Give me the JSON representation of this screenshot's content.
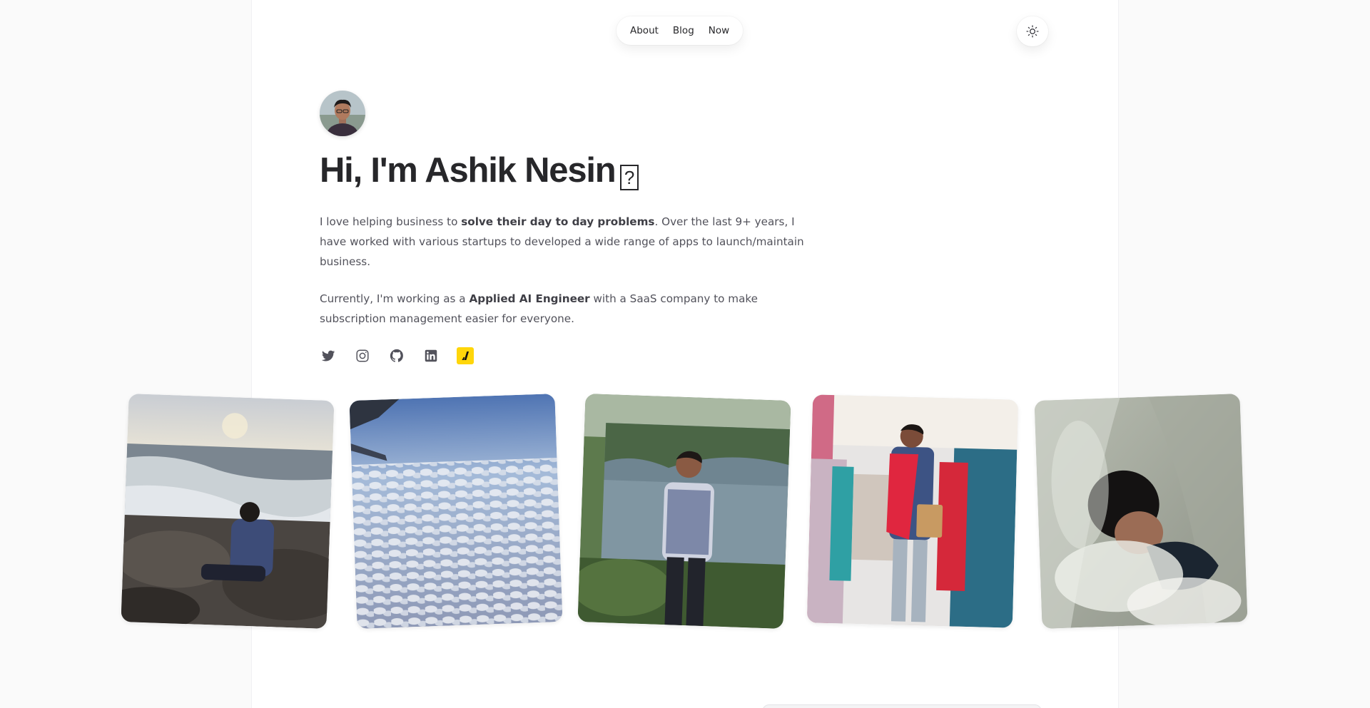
{
  "nav": {
    "items": [
      {
        "label": "About"
      },
      {
        "label": "Blog"
      },
      {
        "label": "Now"
      }
    ]
  },
  "theme_toggle": {
    "icon": "sun-icon"
  },
  "hero": {
    "title": "Hi, I'm Ashik Nesin",
    "title_glyph": "?",
    "bio_1_pre": "I love helping business to ",
    "bio_1_bold": "solve their day to day problems",
    "bio_1_post": ". Over the last 9+ years, I have worked with various startups to developed a wide range of apps to launch/maintain business.",
    "bio_2_pre": "Currently, I'm working as a ",
    "bio_2_bold": "Applied AI Engineer",
    "bio_2_post": " with a SaaS company to make subscription management easier for everyone."
  },
  "socials": [
    {
      "icon": "twitter-icon"
    },
    {
      "icon": "instagram-icon"
    },
    {
      "icon": "github-icon"
    },
    {
      "icon": "linkedin-icon"
    },
    {
      "icon": "brand-icon",
      "color": "#ffd60a"
    }
  ],
  "photos": [
    {
      "subject": "man-sitting-on-rocks-by-sea"
    },
    {
      "subject": "clouds-from-airplane-window"
    },
    {
      "subject": "man-standing-by-mossy-wall"
    },
    {
      "subject": "man-shopping-in-clothing-store"
    },
    {
      "subject": "man-under-waterfall"
    }
  ],
  "colors": {
    "background": "#fafafa",
    "column": "#ffffff",
    "text": "#27272a",
    "muted": "#52525b",
    "accent": "#ffd60a"
  }
}
